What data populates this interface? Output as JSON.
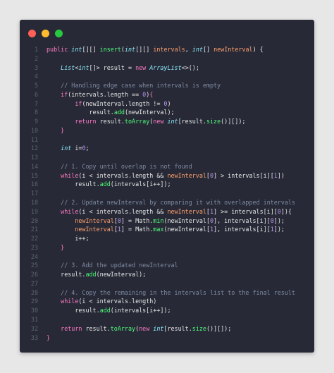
{
  "window": {
    "title_dots": [
      "close",
      "minimize",
      "maximize"
    ]
  },
  "colors": {
    "background": "#e7e7e7",
    "editor": "#272a36",
    "keyword": "#ff79c6",
    "type": "#8be9fd",
    "function": "#50fa7b",
    "number": "#bd93f9",
    "param": "#ff9f6e",
    "comment": "#7f8aa3",
    "plain": "#e6e6e6"
  },
  "code": {
    "lines": [
      [
        [
          "k",
          "public "
        ],
        [
          "t",
          "int"
        ],
        [
          "p",
          "[][] "
        ],
        [
          "f",
          "insert"
        ],
        [
          "p",
          "("
        ],
        [
          "t",
          "int"
        ],
        [
          "p",
          "[][] "
        ],
        [
          "v",
          "intervals"
        ],
        [
          "p",
          ", "
        ],
        [
          "t",
          "int"
        ],
        [
          "p",
          "[] "
        ],
        [
          "v",
          "newInterval"
        ],
        [
          "p",
          ") {"
        ]
      ],
      [],
      [
        [
          "p",
          "    "
        ],
        [
          "t",
          "List"
        ],
        [
          "p",
          "<"
        ],
        [
          "t",
          "int"
        ],
        [
          "p",
          "[]> result = "
        ],
        [
          "k",
          "new "
        ],
        [
          "t",
          "ArrayList"
        ],
        [
          "p",
          "<>();"
        ]
      ],
      [],
      [
        [
          "p",
          "    "
        ],
        [
          "c",
          "// Handling edge case when intervals is empty"
        ]
      ],
      [
        [
          "p",
          "    "
        ],
        [
          "k",
          "if"
        ],
        [
          "p",
          "(intervals.length == "
        ],
        [
          "n",
          "0"
        ],
        [
          "p",
          ")"
        ],
        [
          "k",
          "{"
        ]
      ],
      [
        [
          "p",
          "        "
        ],
        [
          "k",
          "if"
        ],
        [
          "p",
          "(newInterval.length != "
        ],
        [
          "n",
          "0"
        ],
        [
          "p",
          ")"
        ]
      ],
      [
        [
          "p",
          "            result."
        ],
        [
          "f",
          "add"
        ],
        [
          "p",
          "(newInterval);"
        ]
      ],
      [
        [
          "p",
          "        "
        ],
        [
          "k",
          "return "
        ],
        [
          "p",
          "result."
        ],
        [
          "f",
          "toArray"
        ],
        [
          "p",
          "("
        ],
        [
          "k",
          "new "
        ],
        [
          "t",
          "int"
        ],
        [
          "p",
          "[result."
        ],
        [
          "f",
          "size"
        ],
        [
          "p",
          "()][]);"
        ]
      ],
      [
        [
          "p",
          "    "
        ],
        [
          "k",
          "}"
        ]
      ],
      [],
      [
        [
          "p",
          "    "
        ],
        [
          "t",
          "int "
        ],
        [
          "p",
          "i="
        ],
        [
          "n",
          "0"
        ],
        [
          "p",
          ";"
        ]
      ],
      [],
      [
        [
          "p",
          "    "
        ],
        [
          "c",
          "// 1. Copy until overlap is not found"
        ]
      ],
      [
        [
          "p",
          "    "
        ],
        [
          "k",
          "while"
        ],
        [
          "p",
          "(i < intervals.length && "
        ],
        [
          "v",
          "newInterval"
        ],
        [
          "p",
          "["
        ],
        [
          "n",
          "0"
        ],
        [
          "p",
          "] > intervals[i]["
        ],
        [
          "n",
          "1"
        ],
        [
          "p",
          "])"
        ]
      ],
      [
        [
          "p",
          "        result."
        ],
        [
          "f",
          "add"
        ],
        [
          "p",
          "(intervals[i++]);"
        ]
      ],
      [],
      [
        [
          "p",
          "    "
        ],
        [
          "c",
          "// 2. Update newInterval by comparing it with overlapped intervals"
        ]
      ],
      [
        [
          "p",
          "    "
        ],
        [
          "k",
          "while"
        ],
        [
          "p",
          "(i < intervals.length && "
        ],
        [
          "v",
          "newInterval"
        ],
        [
          "p",
          "["
        ],
        [
          "n",
          "1"
        ],
        [
          "p",
          "] >= intervals[i]["
        ],
        [
          "n",
          "0"
        ],
        [
          "p",
          "]){"
        ]
      ],
      [
        [
          "p",
          "        "
        ],
        [
          "v",
          "newInterval"
        ],
        [
          "p",
          "["
        ],
        [
          "n",
          "0"
        ],
        [
          "p",
          "] = Math."
        ],
        [
          "f",
          "min"
        ],
        [
          "p",
          "(newInterval["
        ],
        [
          "n",
          "0"
        ],
        [
          "p",
          "], intervals[i]["
        ],
        [
          "n",
          "0"
        ],
        [
          "p",
          "]);"
        ]
      ],
      [
        [
          "p",
          "        "
        ],
        [
          "v",
          "newInterval"
        ],
        [
          "p",
          "["
        ],
        [
          "n",
          "1"
        ],
        [
          "p",
          "] = Math."
        ],
        [
          "f",
          "max"
        ],
        [
          "p",
          "(newInterval["
        ],
        [
          "n",
          "1"
        ],
        [
          "p",
          "], intervals[i]["
        ],
        [
          "n",
          "1"
        ],
        [
          "p",
          "]);"
        ]
      ],
      [
        [
          "p",
          "        i++;"
        ]
      ],
      [
        [
          "p",
          "    "
        ],
        [
          "k",
          "}"
        ]
      ],
      [],
      [
        [
          "p",
          "    "
        ],
        [
          "c",
          "// 3. Add the updated newInterval"
        ]
      ],
      [
        [
          "p",
          "    result."
        ],
        [
          "f",
          "add"
        ],
        [
          "p",
          "(newInterval);"
        ]
      ],
      [],
      [
        [
          "p",
          "    "
        ],
        [
          "c",
          "// 4. Copy the remaining in the intervals list to the final result"
        ]
      ],
      [
        [
          "p",
          "    "
        ],
        [
          "k",
          "while"
        ],
        [
          "p",
          "(i < intervals.length)"
        ]
      ],
      [
        [
          "p",
          "        result."
        ],
        [
          "f",
          "add"
        ],
        [
          "p",
          "(intervals[i++]);"
        ]
      ],
      [],
      [
        [
          "p",
          "    "
        ],
        [
          "k",
          "return "
        ],
        [
          "p",
          "result."
        ],
        [
          "f",
          "toArray"
        ],
        [
          "p",
          "("
        ],
        [
          "k",
          "new "
        ],
        [
          "t",
          "int"
        ],
        [
          "p",
          "[result."
        ],
        [
          "f",
          "size"
        ],
        [
          "p",
          "()][]);"
        ]
      ],
      [
        [
          "k",
          "}"
        ]
      ]
    ]
  }
}
